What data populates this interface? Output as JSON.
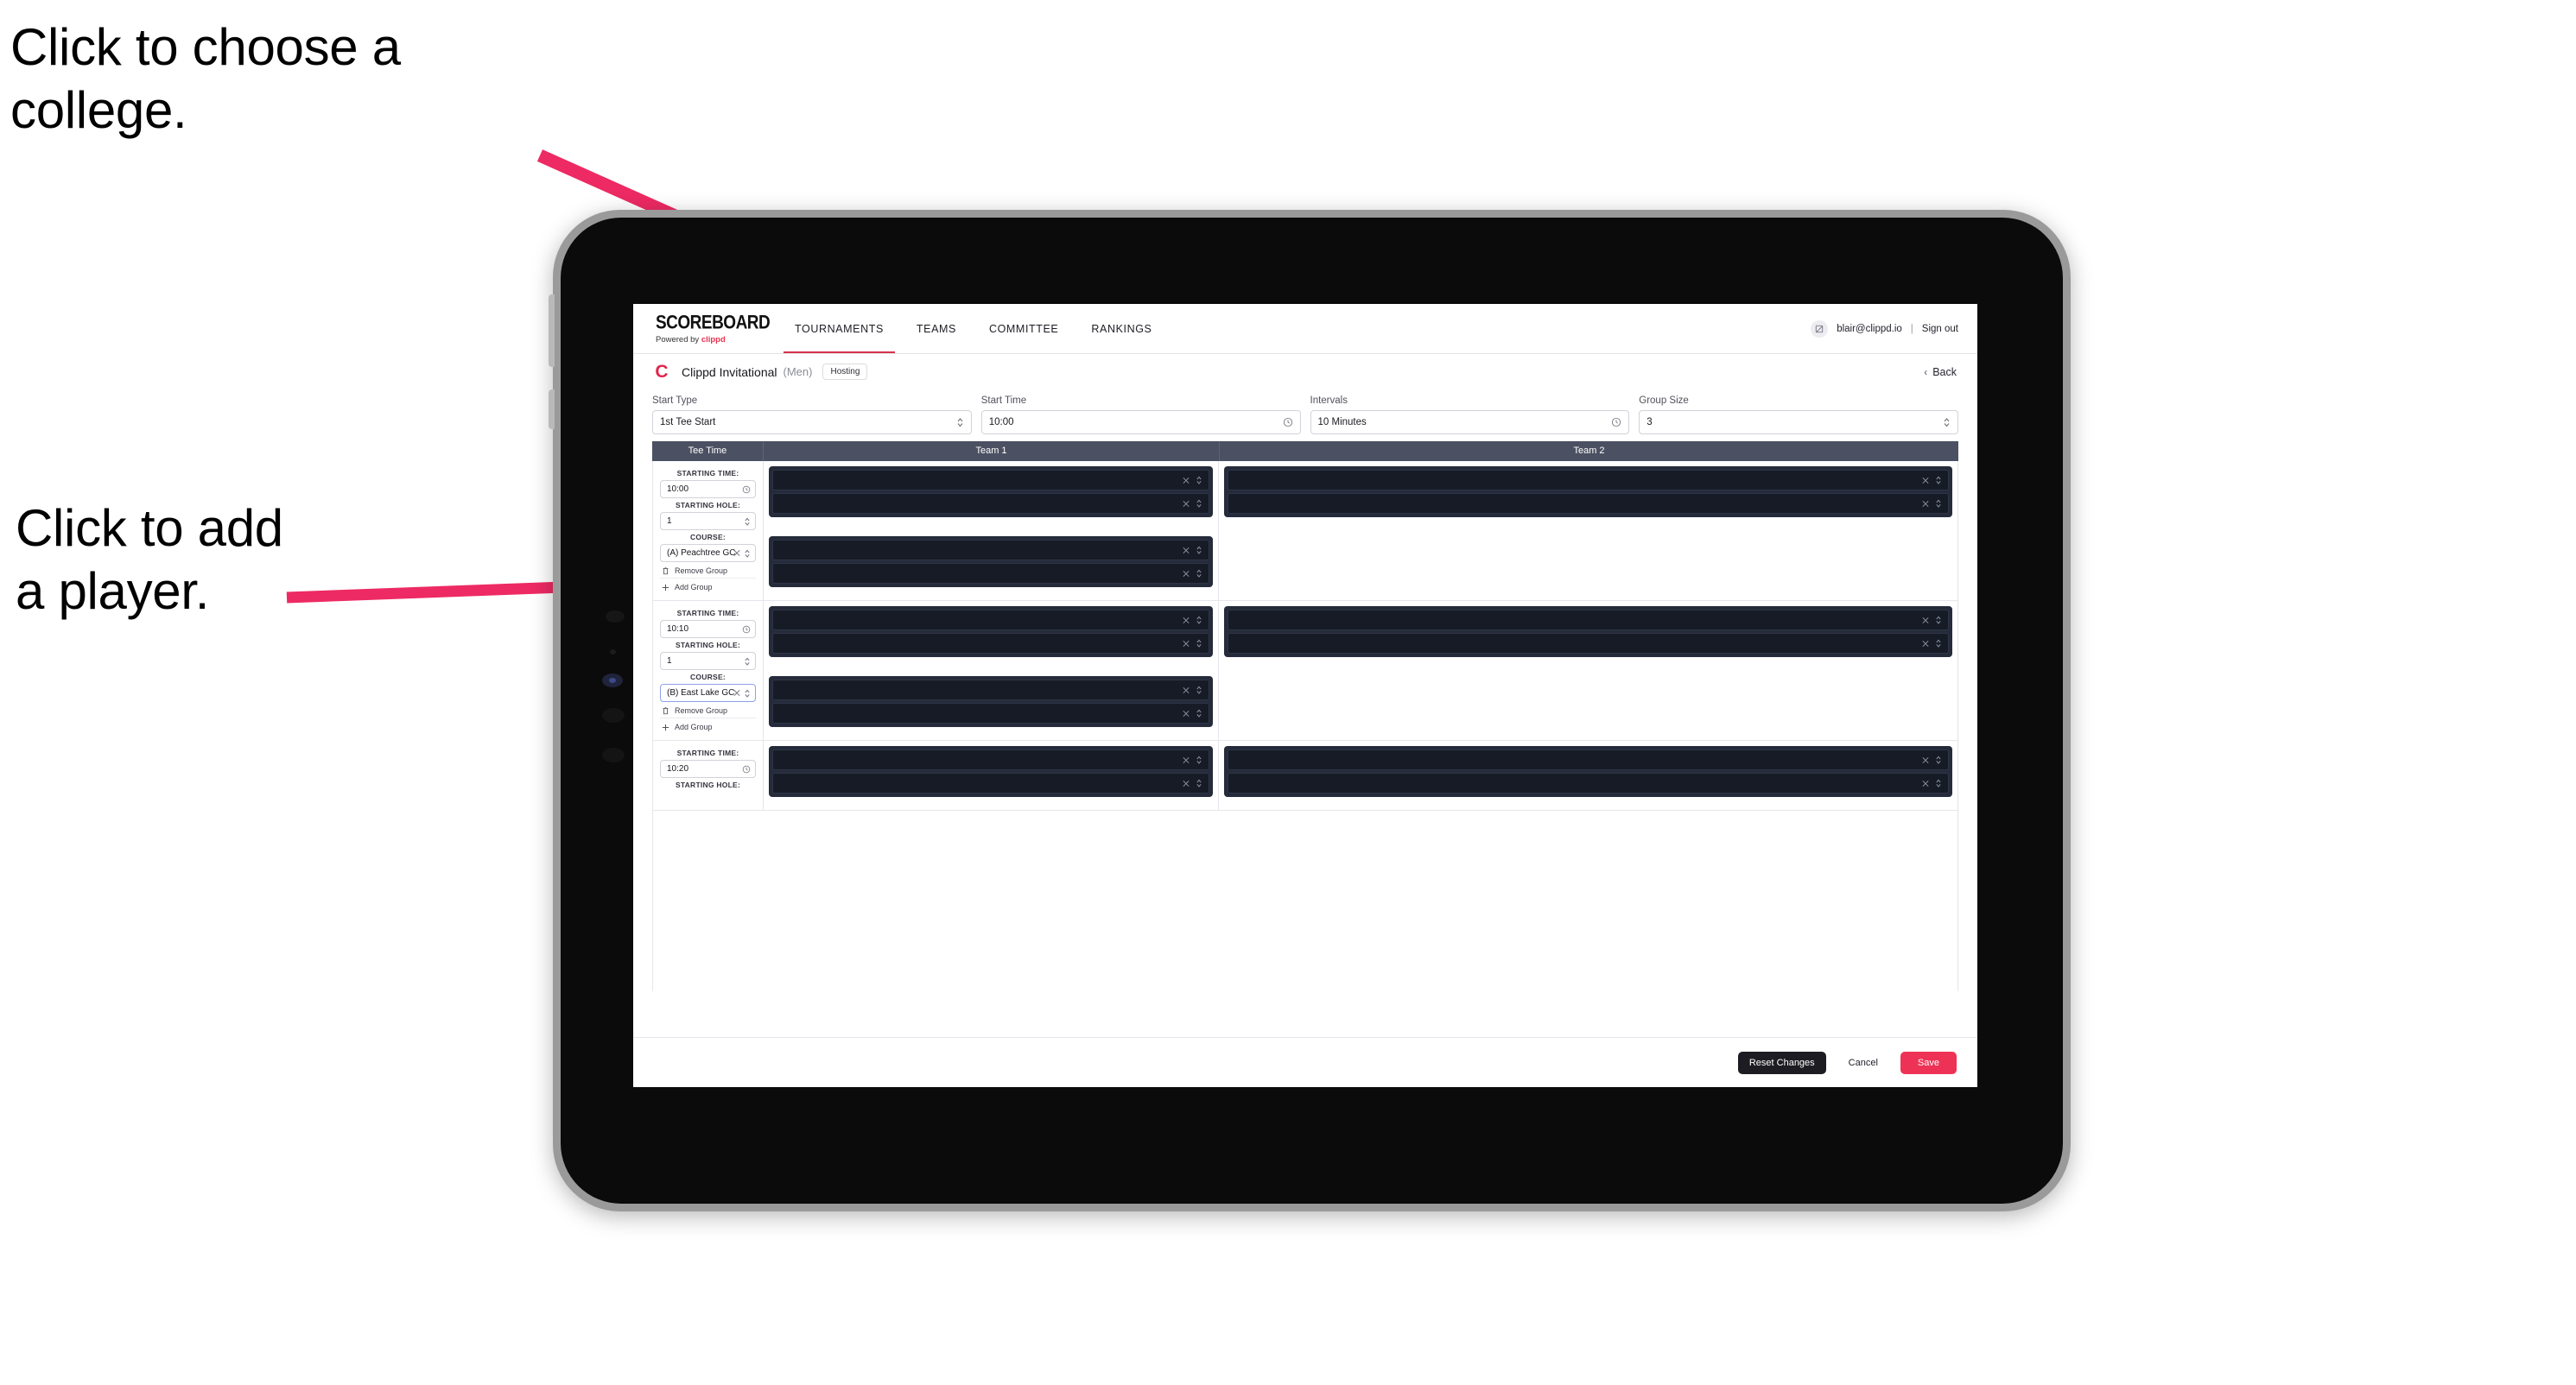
{
  "annotations": [
    {
      "id": "ann-college",
      "text": "Click to choose a\ncollege."
    },
    {
      "id": "ann-player",
      "text": "Click to add\na player."
    }
  ],
  "colors": {
    "accent": "#ee3255",
    "brand_red": "#e0274d",
    "header_bar": "#4b5162",
    "card_dark": "#252b3a",
    "slot_dark": "#161b26",
    "annotation_arrow": "#ed2a63"
  },
  "header": {
    "brand_title": "SCOREBOARD",
    "brand_sub_prefix": "Powered by ",
    "brand_sub_name": "clippd",
    "nav": [
      {
        "label": "TOURNAMENTS",
        "active": true
      },
      {
        "label": "TEAMS",
        "active": false
      },
      {
        "label": "COMMITTEE",
        "active": false
      },
      {
        "label": "RANKINGS",
        "active": false
      }
    ],
    "avatar_icon": "user-avatar-icon",
    "user_email": "blair@clippd.io",
    "separator": "|",
    "sign_out": "Sign out"
  },
  "tournament": {
    "logo_letter": "C",
    "name": "Clippd Invitational",
    "gender": "(Men)",
    "badge": "Hosting",
    "back_label": "Back",
    "back_chevron": "chevron-left-icon"
  },
  "form": {
    "fields": [
      {
        "label": "Start Type",
        "value": "1st Tee Start",
        "adorn": "chevron-updown-icon"
      },
      {
        "label": "Start Time",
        "value": "10:00",
        "adorn": "clock-icon"
      },
      {
        "label": "Intervals",
        "value": "10 Minutes",
        "adorn": "clock-icon"
      },
      {
        "label": "Group Size",
        "value": "3",
        "adorn": "chevron-updown-icon"
      }
    ]
  },
  "grid": {
    "headers": [
      "Tee Time",
      "Team 1",
      "Team 2"
    ],
    "labels": {
      "starting_time": "STARTING TIME:",
      "starting_hole": "STARTING HOLE:",
      "course": "COURSE:",
      "remove_group": "Remove Group",
      "add_group": "Add Group",
      "remove_icon": "trash-icon",
      "add_icon": "plus-icon",
      "clear_icon": "clear-x-icon",
      "stepper_icon": "chevron-updown-icon",
      "clock_icon": "clock-icon"
    },
    "rows": [
      {
        "starting_time": "10:00",
        "starting_hole": "1",
        "course": "(A) Peachtree GC",
        "course_focused": false,
        "team1_cards": [
          {
            "slots": [
              "",
              ""
            ]
          },
          {
            "slots": [
              "",
              ""
            ]
          }
        ],
        "team2_cards": [
          {
            "slots": [
              "",
              ""
            ]
          }
        ]
      },
      {
        "starting_time": "10:10",
        "starting_hole": "1",
        "course": "(B) East Lake GC",
        "course_focused": true,
        "team1_cards": [
          {
            "slots": [
              "",
              ""
            ]
          },
          {
            "slots": [
              "",
              ""
            ]
          }
        ],
        "team2_cards": [
          {
            "slots": [
              "",
              ""
            ]
          }
        ]
      },
      {
        "starting_time": "10:20",
        "starting_hole": "",
        "course": "",
        "course_focused": false,
        "team1_cards": [
          {
            "slots": [
              "",
              ""
            ]
          }
        ],
        "team2_cards": [
          {
            "slots": [
              "",
              ""
            ]
          }
        ]
      }
    ]
  },
  "footer": {
    "reset": "Reset Changes",
    "cancel": "Cancel",
    "save": "Save"
  }
}
